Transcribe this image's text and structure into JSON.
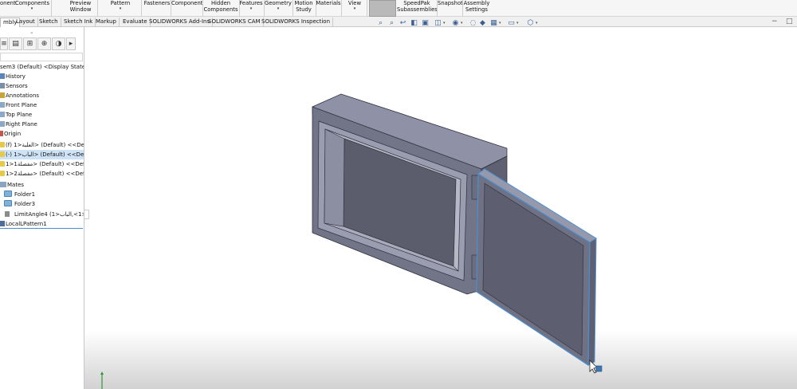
{
  "ribbon": {
    "items": [
      {
        "label": "onent",
        "dropdown": ""
      },
      {
        "label": "Components",
        "dropdown": "▾"
      },
      {
        "label": "Preview\nWindow",
        "dropdown": ""
      },
      {
        "label": "Pattern",
        "dropdown": "▾"
      },
      {
        "label": "Fasteners",
        "dropdown": ""
      },
      {
        "label": "Component",
        "dropdown": ""
      },
      {
        "label": "Hidden\nComponents",
        "dropdown": ""
      },
      {
        "label": "Features",
        "dropdown": "▾"
      },
      {
        "label": "Geometry",
        "dropdown": "▾"
      },
      {
        "label": "Motion\nStudy",
        "dropdown": ""
      },
      {
        "label": "Materials",
        "dropdown": ""
      },
      {
        "label": "View",
        "dropdown": "▾"
      },
      {
        "label": "SpeedPak\nSubassemblies",
        "dropdown": ""
      },
      {
        "label": "Snapshot",
        "dropdown": ""
      },
      {
        "label": "Assembly\nSettings",
        "dropdown": ""
      }
    ]
  },
  "tabs": [
    "mbly",
    "Layout",
    "Sketch",
    "Sketch Ink",
    "Markup",
    "Evaluate",
    "SOLIDWORKS Add-Ins",
    "SOLIDWORKS CAM",
    "SOLIDWORKS Inspection"
  ],
  "active_tab_index": 0,
  "panel": {
    "drag_handle": "«",
    "tab_icons": [
      "feature-manager-icon",
      "property-manager-icon",
      "configuration-manager-icon",
      "dimxpert-icon",
      "appearance-icon"
    ],
    "tab_glyphs": [
      "≡",
      "▤",
      "⊞",
      "⊕",
      "◑",
      "▸"
    ],
    "tree": [
      {
        "text": "sem3 (Default) <Display State-1>",
        "icon": "assembly-icon"
      },
      {
        "text": "History",
        "icon": "history-icon"
      },
      {
        "text": "Sensors",
        "icon": "sensor-icon"
      },
      {
        "text": "Annotations",
        "icon": "annotation-icon"
      },
      {
        "text": "Front Plane",
        "icon": "plane-icon"
      },
      {
        "text": "Top Plane",
        "icon": "plane-icon"
      },
      {
        "text": "Right Plane",
        "icon": "plane-icon"
      },
      {
        "text": "Origin",
        "icon": "origin-icon"
      },
      {
        "text": "(f) العلبة<1> (Default) <<Default>",
        "icon": "part-icon"
      },
      {
        "text": "(-) الباب<1> (Default) <<Default>",
        "icon": "part-icon",
        "selected": true
      },
      {
        "text": "مفصلة1<1> (Default) <<Default>",
        "icon": "part-icon"
      },
      {
        "text": "مفصلة2<1> (Default) <<Default>",
        "icon": "part-icon"
      },
      {
        "text": "Mates",
        "icon": "mates-icon"
      },
      {
        "text": "Folder1",
        "icon": "folder-icon"
      },
      {
        "text": "Folder3",
        "icon": "folder-icon"
      },
      {
        "text": "LimitAngle4 (العلبة<1>,الباب<1>)",
        "icon": "limit-angle-mate-icon"
      },
      {
        "text": "LocalLPattern1",
        "icon": "pattern-icon"
      }
    ]
  },
  "hud_icons": [
    "zoom-to-fit-icon",
    "zoom-area-icon",
    "previous-view-icon",
    "section-view-icon",
    "dynamic-annotation-icon",
    "view-orientation-icon",
    "display-style-icon",
    "hide-show-icon",
    "edit-appearance-icon",
    "apply-scene-icon",
    "view-settings-icon",
    "display-pane-icon"
  ],
  "hud_glyphs": [
    "⌕",
    "⌕",
    "↩",
    "◧",
    "▣",
    "◫",
    "◉",
    "◌",
    "◆",
    "▦",
    "▭",
    "⬡"
  ],
  "window_controls": [
    "−",
    "□"
  ],
  "colors": {
    "selection_highlight": "#4a8fd0",
    "tree_selected_bg": "#cfe3f7",
    "model_body": "#6d6f80"
  }
}
